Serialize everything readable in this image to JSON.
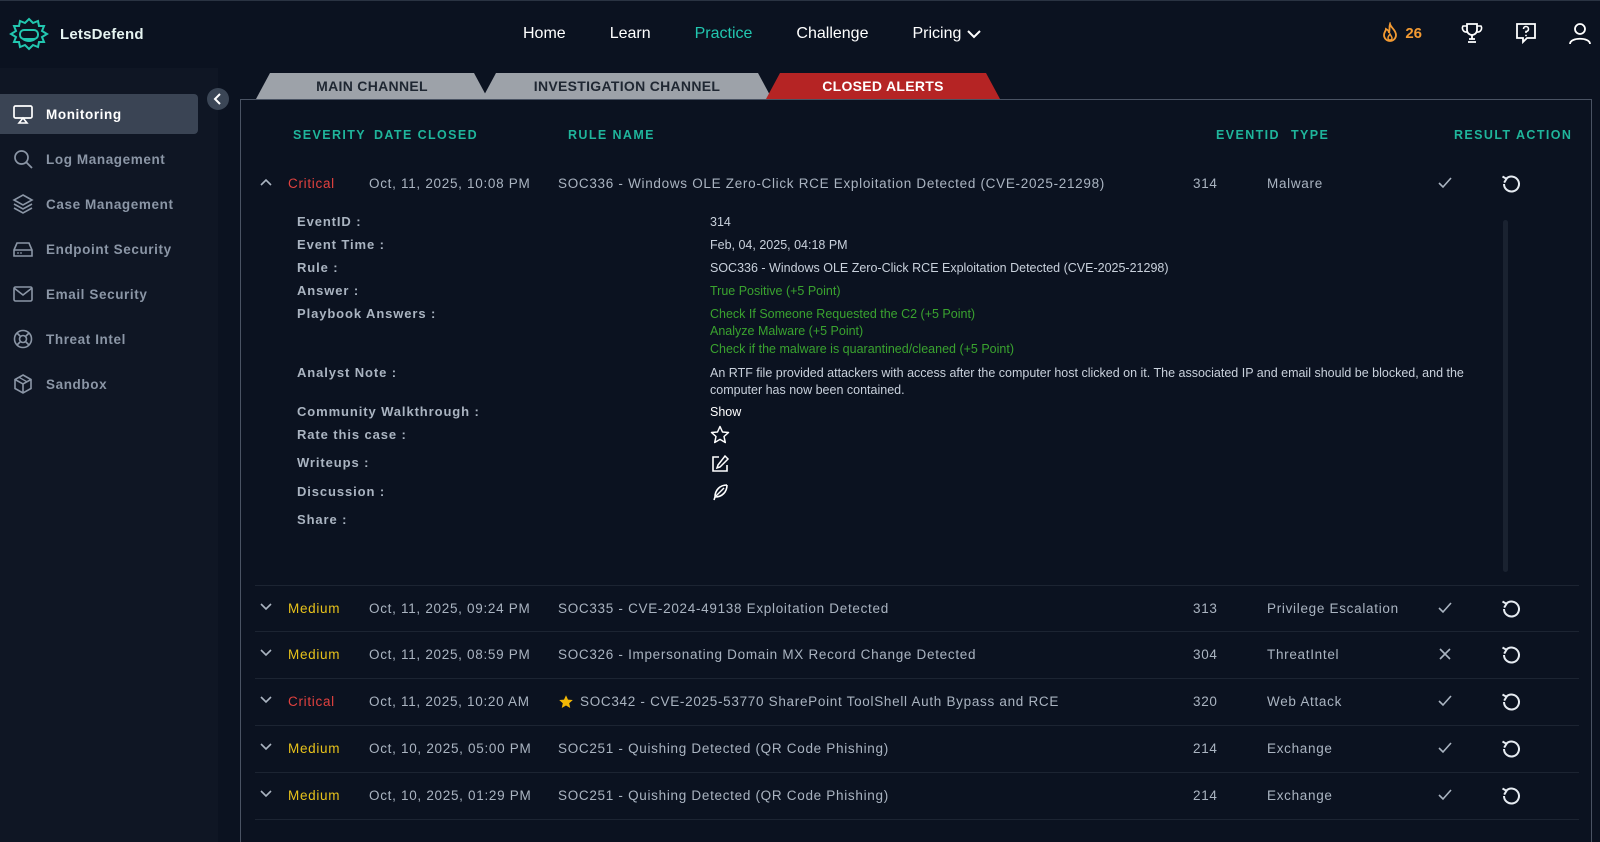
{
  "brand": {
    "name": "LetsDefend"
  },
  "nav": {
    "items": [
      {
        "label": "Home",
        "active": false
      },
      {
        "label": "Learn",
        "active": false
      },
      {
        "label": "Practice",
        "active": true
      },
      {
        "label": "Challenge",
        "active": false
      },
      {
        "label": "Pricing",
        "active": false,
        "dropdown": true
      }
    ]
  },
  "topbar": {
    "streak_count": "26",
    "icons": [
      "flame-icon",
      "trophy-icon",
      "help-icon",
      "user-icon"
    ]
  },
  "sidebar": {
    "items": [
      {
        "label": "Monitoring",
        "icon": "monitor-icon",
        "active": true
      },
      {
        "label": "Log Management",
        "icon": "search-icon"
      },
      {
        "label": "Case Management",
        "icon": "layers-icon"
      },
      {
        "label": "Endpoint Security",
        "icon": "drive-icon"
      },
      {
        "label": "Email Security",
        "icon": "mail-icon"
      },
      {
        "label": "Threat Intel",
        "icon": "lifebuoy-icon"
      },
      {
        "label": "Sandbox",
        "icon": "cube-icon"
      }
    ]
  },
  "tabs": [
    {
      "label": "MAIN CHANNEL",
      "active": false
    },
    {
      "label": "INVESTIGATION CHANNEL",
      "active": false
    },
    {
      "label": "CLOSED ALERTS",
      "active": true
    }
  ],
  "table": {
    "headers": {
      "severity": "SEVERITY",
      "date_closed": "DATE CLOSED",
      "rule_name": "RULE NAME",
      "eventid": "EVENTID",
      "type": "TYPE",
      "result": "RESULT",
      "action": "ACTION"
    },
    "expanded_row": {
      "severity": "Critical",
      "date_closed": "Oct, 11, 2025, 10:08 PM",
      "rule_name": "SOC336 - Windows OLE Zero-Click RCE Exploitation Detected (CVE-2025-21298)",
      "eventid": "314",
      "type": "Malware",
      "result": "check"
    },
    "rows": [
      {
        "severity": "Medium",
        "date_closed": "Oct, 11, 2025, 09:24 PM",
        "rule_name": "SOC335 - CVE-2024-49138 Exploitation Detected",
        "eventid": "313",
        "type": "Privilege Escalation",
        "result": "check",
        "starred": false
      },
      {
        "severity": "Medium",
        "date_closed": "Oct, 11, 2025, 08:59 PM",
        "rule_name": "SOC326 - Impersonating Domain MX Record Change Detected",
        "eventid": "304",
        "type": "ThreatIntel",
        "result": "cross",
        "starred": false
      },
      {
        "severity": "Critical",
        "date_closed": "Oct, 11, 2025, 10:20 AM",
        "rule_name": "SOC342 - CVE-2025-53770 SharePoint ToolShell Auth Bypass and RCE",
        "eventid": "320",
        "type": "Web Attack",
        "result": "check",
        "starred": true
      },
      {
        "severity": "Medium",
        "date_closed": "Oct, 10, 2025, 05:00 PM",
        "rule_name": "SOC251 - Quishing Detected (QR Code Phishing)",
        "eventid": "214",
        "type": "Exchange",
        "result": "check",
        "starred": false
      },
      {
        "severity": "Medium",
        "date_closed": "Oct, 10, 2025, 01:29 PM",
        "rule_name": "SOC251 - Quishing Detected (QR Code Phishing)",
        "eventid": "214",
        "type": "Exchange",
        "result": "check",
        "starred": false
      }
    ]
  },
  "detail": {
    "labels": {
      "eventid": "EventID :",
      "event_time": "Event Time :",
      "rule": "Rule :",
      "answer": "Answer :",
      "playbook_answers": "Playbook Answers :",
      "analyst_note": "Analyst Note :",
      "community_walkthrough": "Community Walkthrough :",
      "rate": "Rate this case :",
      "writeups": "Writeups :",
      "discussion": "Discussion :",
      "share": "Share :"
    },
    "values": {
      "eventid": "314",
      "event_time": "Feb, 04, 2025, 04:18 PM",
      "rule": "SOC336 - Windows OLE Zero-Click RCE Exploitation Detected (CVE-2025-21298)",
      "answer": "True Positive (+5 Point)",
      "playbook_answers": [
        "Check If Someone Requested the C2 (+5 Point)",
        "Analyze Malware (+5 Point)",
        "Check if the malware is quarantined/cleaned (+5 Point)"
      ],
      "analyst_note": "An RTF file provided attackers with access after the computer host clicked on it. The associated IP and email should be blocked, and the computer has now been contained.",
      "community_walkthrough": "Show"
    }
  },
  "colors": {
    "accent": "#22c7b0",
    "critical": "#e0413f",
    "medium": "#e7c21b",
    "active_tab": "#b52424",
    "success": "#3aa32f"
  }
}
